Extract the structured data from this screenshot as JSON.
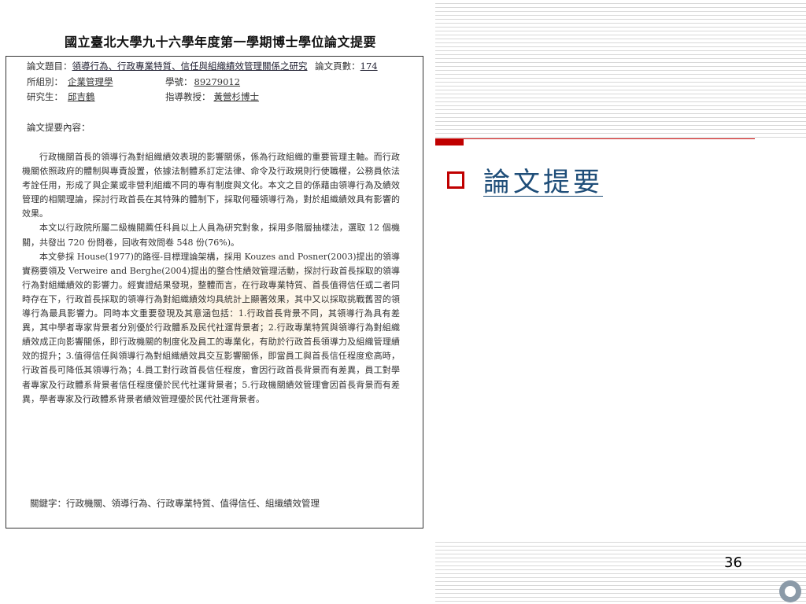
{
  "document": {
    "title": "國立臺北大學九十六學年度第一學期博士學位論文提要",
    "thesis_title_label": "論文題目：",
    "thesis_title": "領導行為、行政專業特質、信任與組織績效管理關係之研究",
    "pages_label": "論文頁數：",
    "pages": "174",
    "department_label": "所組別：",
    "department": "企業管理學",
    "student_id_label": "學號：",
    "student_id": "89279012",
    "student_label": "研究生：",
    "student": "邱吉鶴",
    "advisor_label": "指導教授：",
    "advisor": "黃營杉博士",
    "abstract_label": "論文提要內容：",
    "paragraphs": [
      "行政機關首長的領導行為對組織績效表現的影響關係，係為行政組織的重要管理主軸。而行政機關依照政府的體制與專責設置，依據法制體系訂定法律、命令及行政規則行使職權，公務員依法考詮任用，形成了與企業或非營利組織不同的專有制度與文化。本文之目的係藉由領導行為及績效管理的相關理論，探討行政首長在其特殊的體制下，採取何種領導行為，對於組織績效具有影響的效果。",
      "本文以行政院所屬二級機關薦任科員以上人員為研究對象，採用多階層抽樣法，選取 12 個機關，共發出 720 份問卷，回收有效問卷 548 份(76%)。",
      "本文參採 House(1977)的路徑-目標理論架構，採用 Kouzes and Posner(2003)提出的領導實務要領及 Verweire and Berghe(2004)提出的整合性績效管理活動，探討行政首長採取的領導行為對組織績效的影響力。經實證結果發現，整體而言，在行政專業特質、首長值得信任或二者同時存在下，行政首長採取的領導行為對組織績效均具統計上顯著效果，其中又以採取挑戰舊習的領導行為最具影響力。同時本文重要發現及其意涵包括：1.行政首長背景不同，其領導行為具有差異，其中學者專家背景者分別優於行政體系及民代社運背景者；2.行政專業特質與領導行為對組織績效成正向影響關係，即行政機關的制度化及員工的專業化，有助於行政首長領導力及組織管理績效的提升；3.值得信任與領導行為對組織績效具交互影響關係，即當員工與首長信任程度愈高時，行政首長可降低其領導行為；4.員工對行政首長信任程度，會因行政首長背景而有差異，員工對學者專家及行政體系背景者信任程度優於民代社運背景者；5.行政機關績效管理會因首長背景而有差異，學者專家及行政體系背景者績效管理優於民代社運背景者。"
    ],
    "keywords_label": "關鍵字：",
    "keywords": "行政機關、領導行為、行政專業特質、值得信任、組織績效管理"
  },
  "slide": {
    "heading": "論文提要",
    "page_number": "36"
  },
  "colors": {
    "accent_red": "#c00000",
    "heading_blue": "#1f4e79",
    "circle_gray": "#8b9aa8"
  },
  "icons": {
    "bullet": "hollow-square-bullet-icon",
    "corner": "circle-icon"
  }
}
